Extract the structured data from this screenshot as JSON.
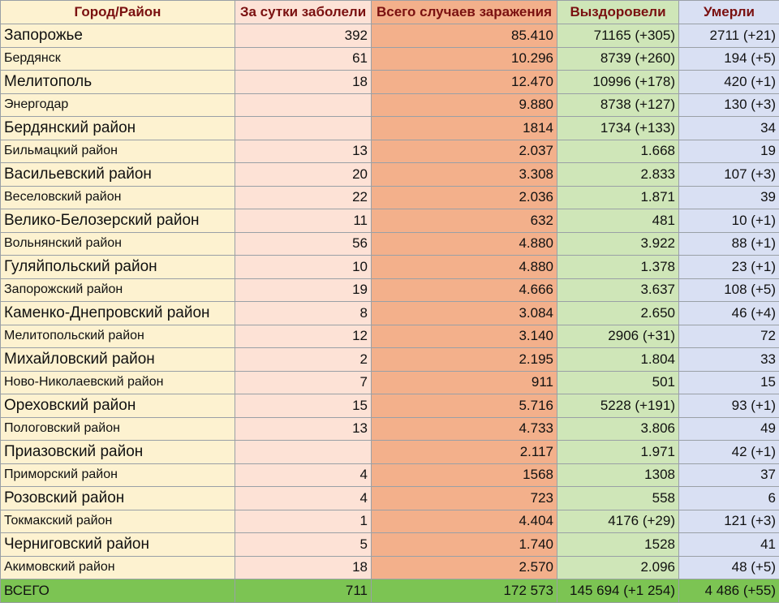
{
  "table": {
    "columns": [
      "Город/Район",
      "За сутки заболели",
      "Всего случаев заражения",
      "Выздоровели",
      "Умерли"
    ],
    "rows": [
      {
        "name": "Запорожье",
        "daily": "392",
        "total": "85.410",
        "recovered": "71165 (+305)",
        "died": "2711 (+21)"
      },
      {
        "name": "Бердянск",
        "daily": "61",
        "total": "10.296",
        "recovered": "8739 (+260)",
        "died": "194 (+5)"
      },
      {
        "name": "Мелитополь",
        "daily": "18",
        "total": "12.470",
        "recovered": "10996 (+178)",
        "died": "420 (+1)"
      },
      {
        "name": "Энергодар",
        "daily": "",
        "total": "9.880",
        "recovered": "8738 (+127)",
        "died": "130 (+3)"
      },
      {
        "name": "Бердянский район",
        "daily": "",
        "total": "1814",
        "recovered": "1734 (+133)",
        "died": "34"
      },
      {
        "name": "Бильмацкий район",
        "daily": "13",
        "total": "2.037",
        "recovered": "1.668",
        "died": "19"
      },
      {
        "name": "Васильевский район",
        "daily": "20",
        "total": "3.308",
        "recovered": "2.833",
        "died": "107 (+3)"
      },
      {
        "name": "Веселовский район",
        "daily": "22",
        "total": "2.036",
        "recovered": "1.871",
        "died": "39"
      },
      {
        "name": "Велико-Белозерский район",
        "daily": "11",
        "total": "632",
        "recovered": "481",
        "died": "10 (+1)"
      },
      {
        "name": "Вольнянский район",
        "daily": "56",
        "total": "4.880",
        "recovered": "3.922",
        "died": "88 (+1)"
      },
      {
        "name": "Гуляйпольский район",
        "daily": "10",
        "total": "4.880",
        "recovered": "1.378",
        "died": "23 (+1)"
      },
      {
        "name": "Запорожский район",
        "daily": "19",
        "total": "4.666",
        "recovered": "3.637",
        "died": "108 (+5)"
      },
      {
        "name": "Каменко-Днепровский район",
        "daily": "8",
        "total": "3.084",
        "recovered": "2.650",
        "died": "46 (+4)"
      },
      {
        "name": "Мелитопольский район",
        "daily": "12",
        "total": "3.140",
        "recovered": "2906 (+31)",
        "died": "72"
      },
      {
        "name": "Михайловский район",
        "daily": "2",
        "total": "2.195",
        "recovered": "1.804",
        "died": "33"
      },
      {
        "name": "Ново-Николаевский район",
        "daily": "7",
        "total": "911",
        "recovered": "501",
        "died": "15"
      },
      {
        "name": "Ореховский район",
        "daily": "15",
        "total": "5.716",
        "recovered": "5228 (+191)",
        "died": "93 (+1)"
      },
      {
        "name": "Пологовский район",
        "daily": "13",
        "total": "4.733",
        "recovered": "3.806",
        "died": "49"
      },
      {
        "name": "Приазовский район",
        "daily": "",
        "total": "2.117",
        "recovered": "1.971",
        "died": "42 (+1)"
      },
      {
        "name": "Приморский район",
        "daily": "4",
        "total": "1568",
        "recovered": "1308",
        "died": "37"
      },
      {
        "name": "Розовский район",
        "daily": "4",
        "total": "723",
        "recovered": "558",
        "died": "6"
      },
      {
        "name": "Токмакский район",
        "daily": "1",
        "total": "4.404",
        "recovered": "4176 (+29)",
        "died": "121 (+3)"
      },
      {
        "name": "Черниговский район",
        "daily": "5",
        "total": "1.740",
        "recovered": "1528",
        "died": "41"
      },
      {
        "name": "Акимовский район",
        "daily": "18",
        "total": "2.570",
        "recovered": "2.096",
        "died": "48 (+5)"
      }
    ],
    "total_row": {
      "name": "ВСЕГО",
      "daily": "711",
      "total": "172 573",
      "recovered": "145 694 (+1 254)",
      "died": "4 486 (+55)"
    }
  }
}
